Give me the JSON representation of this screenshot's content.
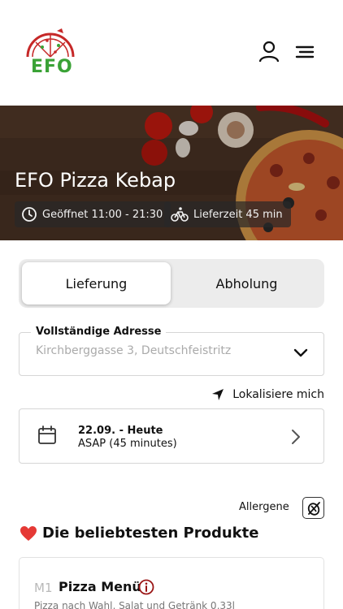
{
  "brand": {
    "logo_text": "EFO",
    "accent": "#3aa236",
    "logo_red": "#c62828"
  },
  "header": {
    "user_icon": "user-icon",
    "menu_icon": "hamburger-menu-icon"
  },
  "hero": {
    "title": "EFO Pizza Kebap",
    "open_hours": "Geöffnet 11:00 - 21:30",
    "delivery_time": "Lieferzeit 45 min"
  },
  "order_mode": {
    "options": [
      "Lieferung",
      "Abholung"
    ],
    "selected": "Lieferung"
  },
  "address": {
    "label": "Vollständige Adresse",
    "placeholder": "Kirchberggasse 3, Deutschfeistritz"
  },
  "locate": {
    "label": "Lokalisiere mich"
  },
  "schedule": {
    "date": "22.09. - Heute",
    "time": "ASAP (45 minutes)"
  },
  "allergens": {
    "label": "Allergene"
  },
  "popular": {
    "title": "Die beliebtesten Produkte",
    "items": [
      {
        "code": "M1",
        "name": "Pizza Menü",
        "description": "Pizza nach Wahl, Salat und Getränk 0,33l"
      }
    ]
  }
}
